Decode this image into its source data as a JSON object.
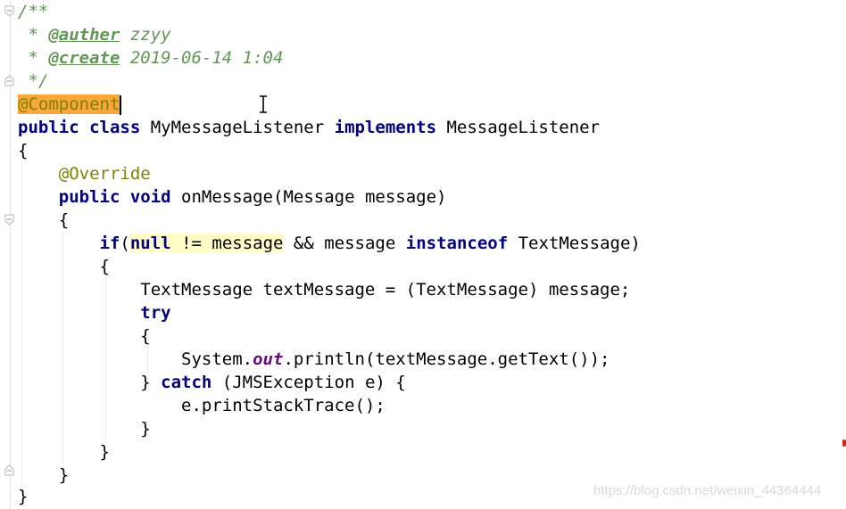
{
  "editor": {
    "lines": {
      "l1": "/**",
      "l2_star": " * ",
      "l2_tag": "@auther",
      "l2_val": " zzyy",
      "l3_star": " * ",
      "l3_tag": "@create",
      "l3_val": " 2019-06-14 1:04",
      "l4": " */",
      "l5_anno": "@Component",
      "l6_kw1": "public class",
      "l6_name": " MyMessageListener ",
      "l6_kw2": "implements",
      "l6_iface": " MessageListener",
      "l7": "{",
      "l8_indent": "    ",
      "l8_anno": "@Override",
      "l9_indent": "    ",
      "l9_kw": "public void",
      "l9_rest": " onMessage(Message message)",
      "l10": "    {",
      "l11_indent": "        ",
      "l11_kw": "if",
      "l11_paren": "(",
      "l11_null": "null",
      "l11_hl": " != message",
      "l11_mid": " && message ",
      "l11_kw2": "instanceof",
      "l11_rest": " TextMessage)",
      "l12": "        {",
      "l13": "            TextMessage textMessage = (TextMessage) message;",
      "l14_indent": "            ",
      "l14_kw": "try",
      "l15": "            {",
      "l16_a": "                System.",
      "l16_fld": "out",
      "l16_b": ".println(textMessage.getText());",
      "l17_a": "            } ",
      "l17_kw": "catch",
      "l17_b": " (JMSException e) {",
      "l18": "                e.printStackTrace();",
      "l19": "            }",
      "l20": "        }",
      "l21": "    }",
      "l22": "}"
    }
  },
  "watermark": "https://blog.csdn.net/weixin_44364444",
  "colors": {
    "keyword": "#000080",
    "annotation": "#808000",
    "annotation_highlight": "#f9a73a",
    "doc_comment": "#629755",
    "static_field": "#660e7a",
    "usage_highlight": "#fffcc8"
  }
}
